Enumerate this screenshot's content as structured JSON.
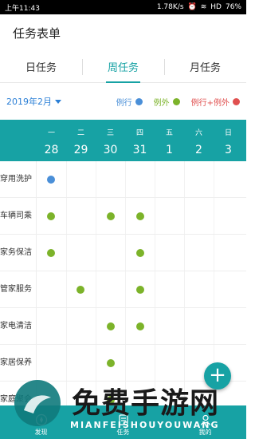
{
  "statusbar": {
    "time": "上午11:43",
    "network": "1.78K/s",
    "signal": "HD",
    "battery": "76%"
  },
  "appbar": {
    "title": "任务表单"
  },
  "tabs": [
    {
      "label": "日任务",
      "active": false
    },
    {
      "label": "周任务",
      "active": true
    },
    {
      "label": "月任务",
      "active": false
    }
  ],
  "filter": {
    "month": "2019年2月",
    "legend": [
      {
        "label": "例行",
        "color": "#4a8fd8"
      },
      {
        "label": "例外",
        "color": "#7cb32a"
      },
      {
        "label": "例行+例外",
        "color": "#e0504f"
      }
    ]
  },
  "week": {
    "days": [
      "一",
      "二",
      "三",
      "四",
      "五",
      "六",
      "日"
    ],
    "dates": [
      "28",
      "29",
      "30",
      "31",
      "1",
      "2",
      "3"
    ]
  },
  "rows": [
    {
      "label": "穿用洗护",
      "marks": [
        "blue",
        "",
        "",
        "",
        "",
        "",
        ""
      ]
    },
    {
      "label": "车辆司乘",
      "marks": [
        "green",
        "",
        "green",
        "green",
        "",
        "",
        ""
      ]
    },
    {
      "label": "家务保洁",
      "marks": [
        "green",
        "",
        "",
        "green",
        "",
        "",
        ""
      ]
    },
    {
      "label": "管家服务",
      "marks": [
        "",
        "green",
        "",
        "green",
        "",
        "",
        ""
      ]
    },
    {
      "label": "家电清洁",
      "marks": [
        "",
        "",
        "green",
        "green",
        "",
        "",
        ""
      ]
    },
    {
      "label": "家居保养",
      "marks": [
        "",
        "",
        "green",
        "",
        "",
        "",
        ""
      ]
    },
    {
      "label": "家庭聚会",
      "marks": [
        "",
        "",
        "green",
        "",
        "",
        "",
        ""
      ]
    }
  ],
  "colors": {
    "accent": "#17a2a4",
    "blue": "#4a8fd8",
    "green": "#7cb32a",
    "red": "#e0504f"
  },
  "fab": {
    "label": "+"
  },
  "bottomnav": [
    {
      "label": "发现",
      "icon": "compass-icon"
    },
    {
      "label": "任务",
      "icon": "task-icon"
    },
    {
      "label": "我的",
      "icon": "user-icon"
    }
  ],
  "watermark": {
    "title": "免费手游网",
    "subtitle": "MIANFEISHOUYOUWANG"
  }
}
